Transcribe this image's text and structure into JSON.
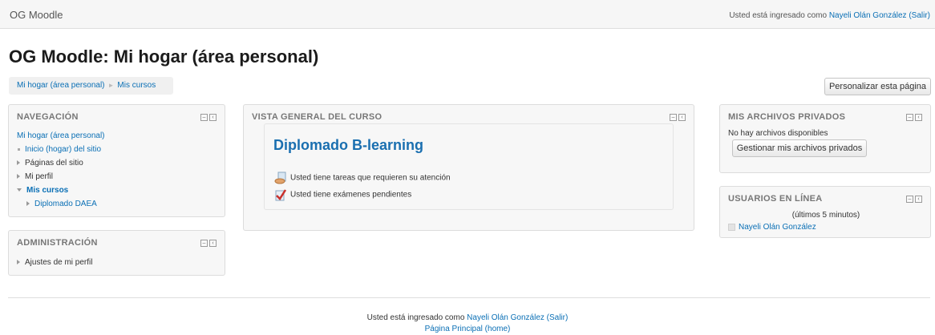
{
  "navbar": {
    "brand": "OG Moodle",
    "login_prefix": "Usted está ingresado como",
    "user_name": "Nayeli Olán González",
    "logout": "(Salir)"
  },
  "page_title": "OG Moodle: Mi hogar (área personal)",
  "breadcrumb": {
    "items": [
      "Mi hogar (área personal)",
      "Mis cursos"
    ],
    "separator": "►"
  },
  "customize_button": "Personalizar esta página",
  "navigation": {
    "title": "NAVEGACIÓN",
    "home": "Mi hogar (área personal)",
    "items": [
      {
        "label": "Inicio (hogar) del sitio"
      },
      {
        "label": "Páginas del sitio"
      },
      {
        "label": "Mi perfil"
      },
      {
        "label": "Mis cursos"
      },
      {
        "label": "Diplomado DAEA"
      }
    ]
  },
  "administration": {
    "title": "ADMINISTRACIÓN",
    "items": [
      {
        "label": "Ajustes de mi perfil"
      }
    ]
  },
  "course_overview": {
    "title": "VISTA GENERAL DEL CURSO",
    "course_name": "Diplomado B-learning",
    "notices": [
      {
        "text": "Usted tiene tareas que requieren su atención",
        "icon": "assignment-icon"
      },
      {
        "text": "Usted tiene exámenes pendientes",
        "icon": "quiz-icon"
      }
    ]
  },
  "private_files": {
    "title": "MIS ARCHIVOS PRIVADOS",
    "empty_text": "No hay archivos disponibles",
    "manage_button": "Gestionar mis archivos privados"
  },
  "online_users": {
    "title": "USUARIOS EN LÍNEA",
    "period": "(últimos 5 minutos)",
    "users": [
      "Nayeli Olán González"
    ]
  },
  "footer": {
    "login_prefix": "Usted está ingresado como",
    "user_name": "Nayeli Olán González",
    "logout": "(Salir)",
    "home_link": "Página Principal (home)"
  },
  "colors": {
    "link": "#0a6fb5",
    "course_title": "#1a6fb0",
    "block_bg": "#f7f7f7"
  }
}
